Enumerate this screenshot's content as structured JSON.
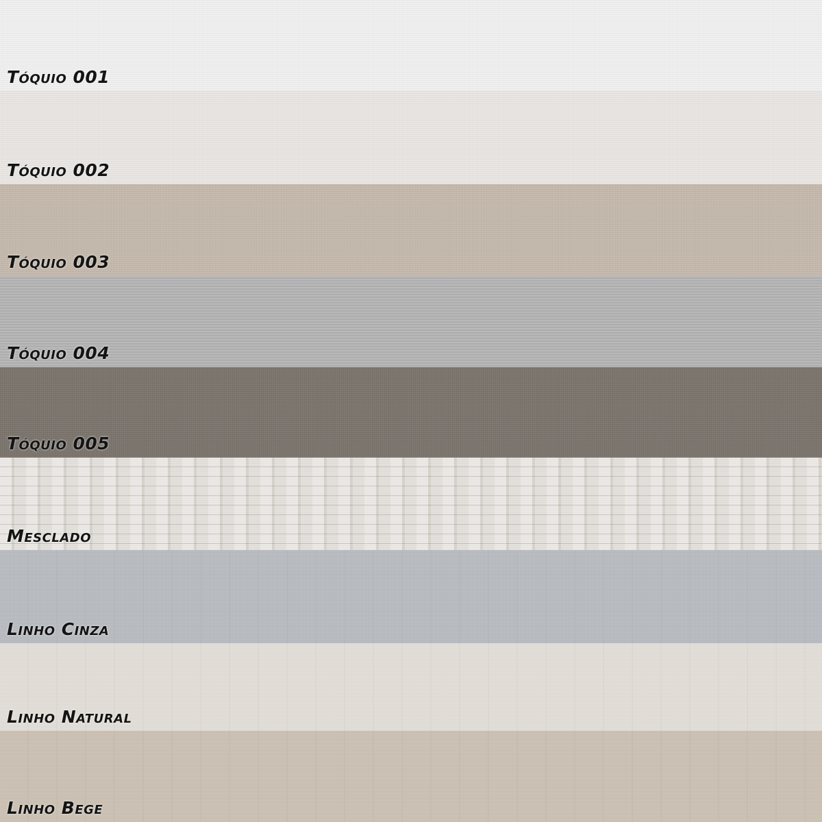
{
  "swatches": [
    {
      "name": "Tóquio 001",
      "color": "#efefef",
      "texture": "fine"
    },
    {
      "name": "Tóquio 002",
      "color": "#e8e5e2",
      "texture": "fine"
    },
    {
      "name": "Tóquio 003",
      "color": "#c4b9ac",
      "texture": "fine"
    },
    {
      "name": "Tóquio 004",
      "color": "#b3b2b3",
      "texture": "stripe"
    },
    {
      "name": "Tóquio 005",
      "color": "#817a73",
      "texture": "weave"
    },
    {
      "name": "Mesclado",
      "color": "#e4e1dc",
      "texture": "melange"
    },
    {
      "name": "Linho Cinza",
      "color": "#b9bcc1",
      "texture": "linen"
    },
    {
      "name": "Linho Natural",
      "color": "#e4e0d9",
      "texture": "linen"
    },
    {
      "name": "Linho Bege",
      "color": "#cdc2b4",
      "texture": "linen"
    }
  ]
}
